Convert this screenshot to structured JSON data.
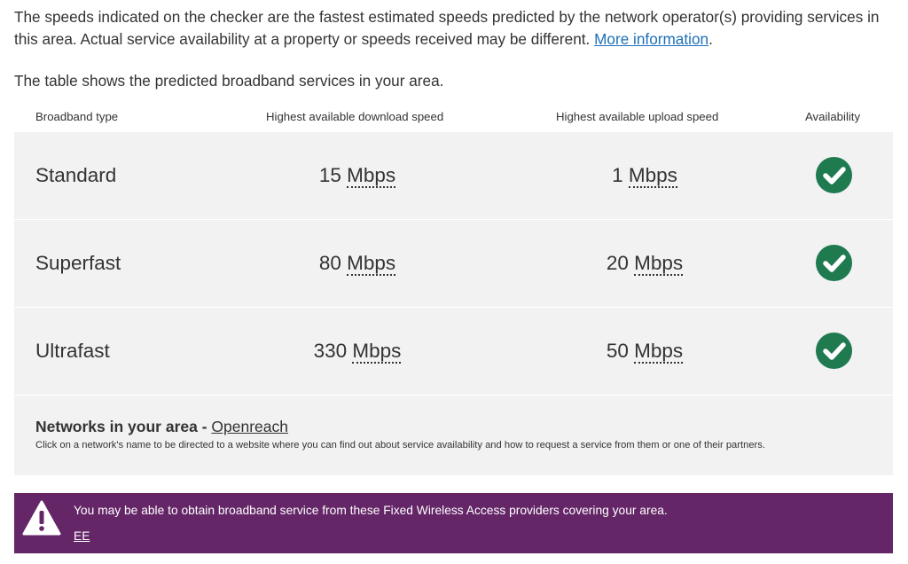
{
  "intro": {
    "text": "The speeds indicated on the checker are the fastest estimated speeds predicted by the network operator(s) providing services in this area. Actual service availability at a property or speeds received may be different. ",
    "link": "More information",
    "suffix": "."
  },
  "lead": "The table shows the predicted broadband services in your area.",
  "table": {
    "headers": {
      "type": "Broadband type",
      "download": "Highest available download speed",
      "upload": "Highest available upload speed",
      "availability": "Availability"
    },
    "rows": [
      {
        "type": "Standard",
        "download": "15",
        "download_unit": "Mbps",
        "upload": "1",
        "upload_unit": "Mbps",
        "available": true
      },
      {
        "type": "Superfast",
        "download": "80",
        "download_unit": "Mbps",
        "upload": "20",
        "upload_unit": "Mbps",
        "available": true
      },
      {
        "type": "Ultrafast",
        "download": "330",
        "download_unit": "Mbps",
        "upload": "50",
        "upload_unit": "Mbps",
        "available": true
      }
    ],
    "icons": {
      "available": "check-circle-icon"
    },
    "colors": {
      "available": "#1f7a50"
    }
  },
  "networks": {
    "title": "Networks in your area - ",
    "link": "Openreach",
    "note": "Click on a network's name to be directed to a website where you can find out about service availability and how to request a service from them or one of their partners."
  },
  "fwa": {
    "message": "You may be able to obtain broadband service from these Fixed Wireless Access providers covering your area.",
    "provider": "EE",
    "icon": "warning-icon",
    "color": "#642667"
  }
}
